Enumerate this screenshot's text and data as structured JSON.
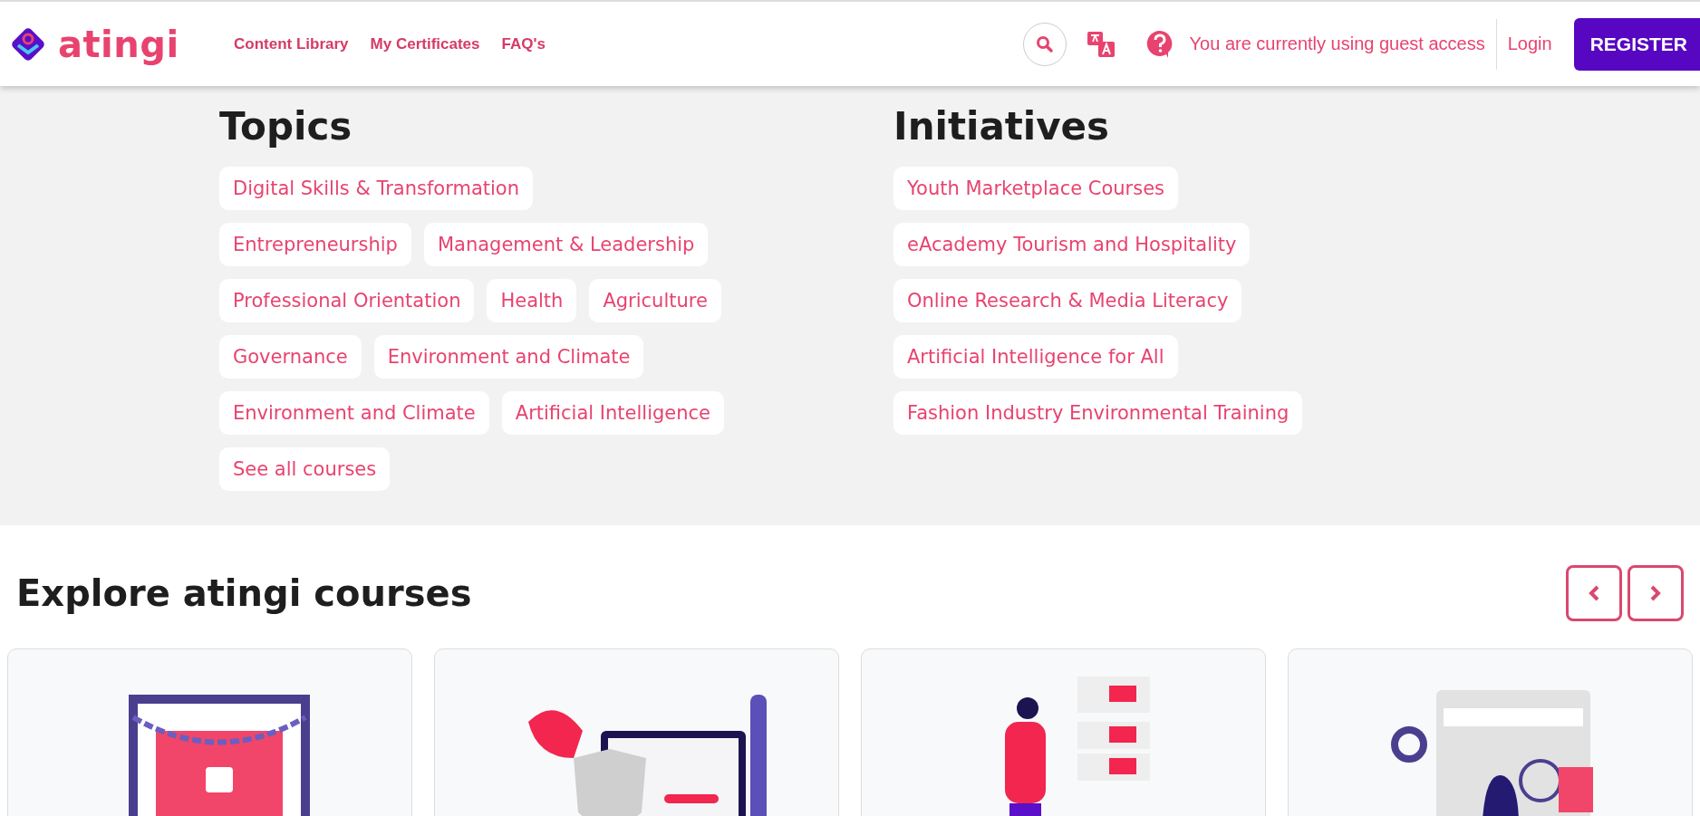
{
  "header": {
    "brand": "atingi",
    "nav": [
      "Content Library",
      "My Certificates",
      "FAQ's"
    ],
    "guest_notice": "You are currently using guest access",
    "login": "Login",
    "register": "REGISTER"
  },
  "topics": {
    "title": "Topics",
    "items": [
      "Digital Skills & Transformation",
      "Entrepreneurship",
      "Management & Leadership",
      "Professional Orientation",
      "Health",
      "Agriculture",
      "Governance",
      "Environment and Climate",
      "Environment and Climate",
      "Artificial Intelligence",
      "See all courses"
    ]
  },
  "initiatives": {
    "title": "Initiatives",
    "items": [
      "Youth Marketplace Courses",
      "eAcademy Tourism and Hospitality",
      "Online Research & Media Literacy",
      "Artificial Intelligence for All",
      "Fashion Industry Environmental Training"
    ]
  },
  "explore": {
    "title": "Explore atingi courses",
    "courses": [
      {
        "kind": "lock"
      },
      {
        "kind": "shield"
      },
      {
        "kind": "mail"
      },
      {
        "kind": "browser"
      }
    ]
  }
}
